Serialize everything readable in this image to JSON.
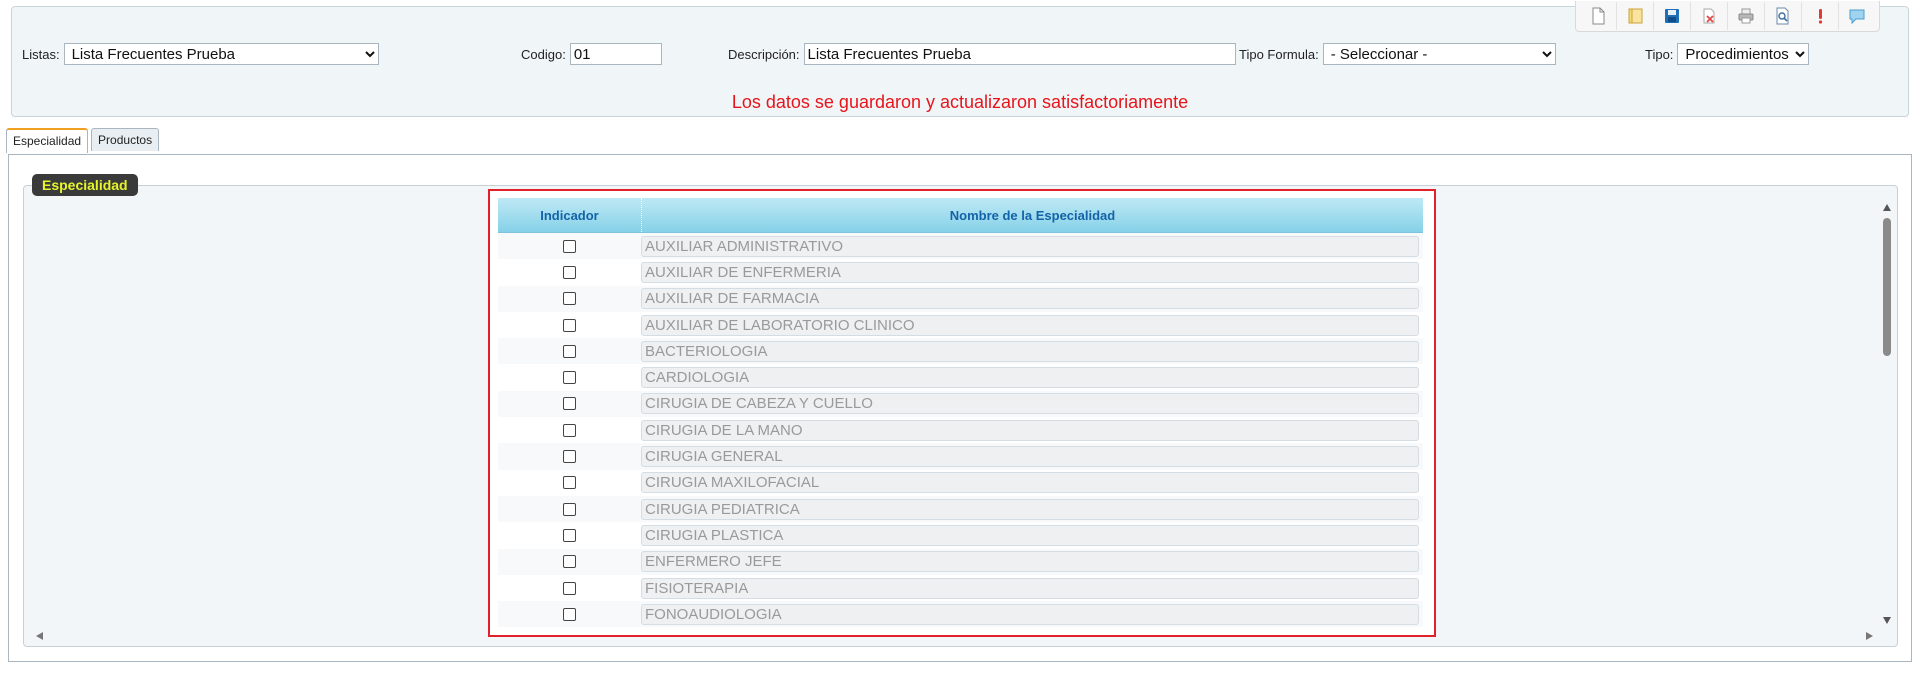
{
  "form": {
    "listas_label": "Listas:",
    "listas_value": "Lista Frecuentes Prueba",
    "codigo_label": "Codigo:",
    "codigo_value": "01",
    "descripcion_label": "Descripción:",
    "descripcion_value": "Lista Frecuentes Prueba",
    "tipo_formula_label": "Tipo Formula:",
    "tipo_formula_value": "- Seleccionar -",
    "tipo_label": "Tipo:",
    "tipo_value": "Procedimientos"
  },
  "message": "Los datos se guardaron y actualizaron satisfactoriamente",
  "toolbar": {
    "icons": [
      "new-document-icon",
      "open-folder-icon",
      "save-icon",
      "delete-icon",
      "print-icon",
      "search-document-icon",
      "alert-icon",
      "chat-icon"
    ]
  },
  "tabs": [
    {
      "label": "Especialidad",
      "active": true
    },
    {
      "label": "Productos",
      "active": false
    }
  ],
  "section": {
    "legend": "Especialidad"
  },
  "table": {
    "columns": [
      "Indicador",
      "Nombre de la Especialidad"
    ],
    "rows": [
      "AUXILIAR ADMINISTRATIVO",
      "AUXILIAR DE ENFERMERIA",
      "AUXILIAR DE FARMACIA",
      "AUXILIAR DE LABORATORIO CLINICO",
      "BACTERIOLOGIA",
      "CARDIOLOGIA",
      "CIRUGIA DE CABEZA Y CUELLO",
      "CIRUGIA DE LA MANO",
      "CIRUGIA GENERAL",
      "CIRUGIA MAXILOFACIAL",
      "CIRUGIA PEDIATRICA",
      "CIRUGIA PLASTICA",
      "ENFERMERO JEFE",
      "FISIOTERAPIA",
      "FONOAUDIOLOGIA"
    ]
  },
  "colors": {
    "message": "#e8141b",
    "legend_bg": "#3a3a3a",
    "legend_text": "#e6f52a",
    "highlight_border": "#e0202a",
    "header_text": "#1463a8"
  }
}
